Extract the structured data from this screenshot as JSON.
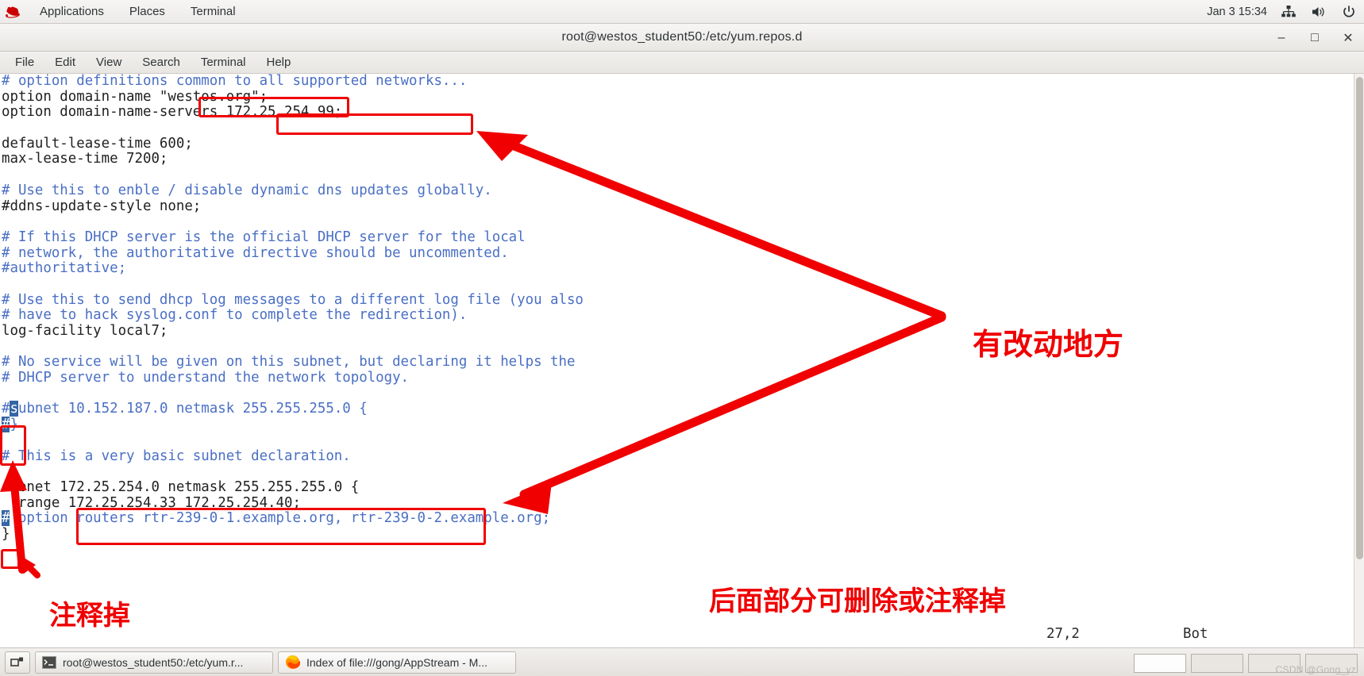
{
  "top_panel": {
    "logo_icon": "redhat-logo-icon",
    "items": [
      {
        "label": "Applications",
        "name": "menu-applications"
      },
      {
        "label": "Places",
        "name": "menu-places"
      },
      {
        "label": "Terminal",
        "name": "menu-terminal"
      }
    ],
    "clock": "Jan 3  15:34",
    "tray_icons": [
      "network-icon",
      "volume-icon",
      "power-icon"
    ]
  },
  "window": {
    "title": "root@westos_student50:/etc/yum.repos.d",
    "buttons": {
      "minimize": "–",
      "maximize": "□",
      "close": "✕"
    },
    "menu": [
      {
        "label": "File",
        "name": "menu-file"
      },
      {
        "label": "Edit",
        "name": "menu-edit"
      },
      {
        "label": "View",
        "name": "menu-view"
      },
      {
        "label": "Search",
        "name": "menu-search"
      },
      {
        "label": "Terminal",
        "name": "menu-terminal-win"
      },
      {
        "label": "Help",
        "name": "menu-help"
      }
    ]
  },
  "editor": {
    "lines": [
      {
        "segments": [
          {
            "t": "# option definitions common to all supported networks...",
            "c": "cmt"
          }
        ]
      },
      {
        "segments": [
          {
            "t": "option domain-name \"westos.org\";",
            "c": "plain"
          }
        ]
      },
      {
        "segments": [
          {
            "t": "option domain-name-servers 172.25.254.99;",
            "c": "plain"
          }
        ]
      },
      {
        "segments": [
          {
            "t": "",
            "c": "plain"
          }
        ]
      },
      {
        "segments": [
          {
            "t": "default-lease-time 600;",
            "c": "plain"
          }
        ]
      },
      {
        "segments": [
          {
            "t": "max-lease-time 7200;",
            "c": "plain"
          }
        ]
      },
      {
        "segments": [
          {
            "t": "",
            "c": "plain"
          }
        ]
      },
      {
        "segments": [
          {
            "t": "# Use this to enble / disable dynamic dns updates globally.",
            "c": "cmt"
          }
        ]
      },
      {
        "segments": [
          {
            "t": "#ddns-update-style none;",
            "c": "plain"
          }
        ]
      },
      {
        "segments": [
          {
            "t": "",
            "c": "plain"
          }
        ]
      },
      {
        "segments": [
          {
            "t": "# If this DHCP server is the official DHCP server for the local",
            "c": "cmt"
          }
        ]
      },
      {
        "segments": [
          {
            "t": "# network, the authoritative directive should be uncommented.",
            "c": "cmt"
          }
        ]
      },
      {
        "segments": [
          {
            "t": "#authoritative;",
            "c": "cmt"
          }
        ]
      },
      {
        "segments": [
          {
            "t": "",
            "c": "plain"
          }
        ]
      },
      {
        "segments": [
          {
            "t": "# Use this to send dhcp log messages to a different log file (you also",
            "c": "cmt"
          }
        ]
      },
      {
        "segments": [
          {
            "t": "# have to hack syslog.conf to complete the redirection).",
            "c": "cmt"
          }
        ]
      },
      {
        "segments": [
          {
            "t": "log-facility local7;",
            "c": "plain"
          }
        ]
      },
      {
        "segments": [
          {
            "t": "",
            "c": "plain"
          }
        ]
      },
      {
        "segments": [
          {
            "t": "# No service will be given on this subnet, but declaring it helps the",
            "c": "cmt"
          }
        ]
      },
      {
        "segments": [
          {
            "t": "# DHCP server to understand the network topology.",
            "c": "cmt"
          }
        ]
      },
      {
        "segments": [
          {
            "t": "",
            "c": "plain"
          }
        ]
      },
      {
        "segments": [
          {
            "t": "#",
            "c": "cmt"
          },
          {
            "t": "s",
            "c": "cursor"
          },
          {
            "t": "ubnet 10.152.187.0 netmask 255.255.255.0 {",
            "c": "cmt"
          }
        ]
      },
      {
        "segments": [
          {
            "t": "#",
            "c": "cursor"
          },
          {
            "t": "}",
            "c": "cmt"
          }
        ]
      },
      {
        "segments": [
          {
            "t": "",
            "c": "plain"
          }
        ]
      },
      {
        "segments": [
          {
            "t": "# This is a very basic subnet declaration.",
            "c": "cmt"
          }
        ]
      },
      {
        "segments": [
          {
            "t": "",
            "c": "plain"
          }
        ]
      },
      {
        "segments": [
          {
            "t": "subnet 172.25.254.0 netmask 255.255.255.0 {",
            "c": "plain"
          }
        ]
      },
      {
        "segments": [
          {
            "t": "  range 172.25.254.33 172.25.254.40;",
            "c": "plain"
          }
        ]
      },
      {
        "segments": [
          {
            "t": "#",
            "c": "cursor"
          },
          {
            "t": " option routers rtr-239-0-1.example.org, rtr-239-0-2.example.org;",
            "c": "cmt"
          }
        ]
      },
      {
        "segments": [
          {
            "t": "}",
            "c": "plain"
          }
        ]
      }
    ],
    "status": {
      "position": "27,2",
      "scroll": "Bot"
    }
  },
  "annotations": {
    "accent_color": "#f00000",
    "notes": [
      {
        "text": "有改动地方",
        "name": "note-changed-places"
      },
      {
        "text": "注释掉",
        "name": "note-comment-out"
      },
      {
        "text": "后面部分可删除或注释掉",
        "name": "note-delete-or-comment"
      }
    ]
  },
  "taskbar": {
    "show_desktop_icon": "show-desktop-icon",
    "tasks": [
      {
        "label": "root@westos_student50:/etc/yum.r...",
        "icon": "terminal-icon",
        "name": "taskbar-terminal"
      },
      {
        "label": "Index of file:///gong/AppStream - M...",
        "icon": "firefox-icon",
        "name": "taskbar-firefox"
      }
    ],
    "watermark": "CSDN @Gong_yz"
  }
}
